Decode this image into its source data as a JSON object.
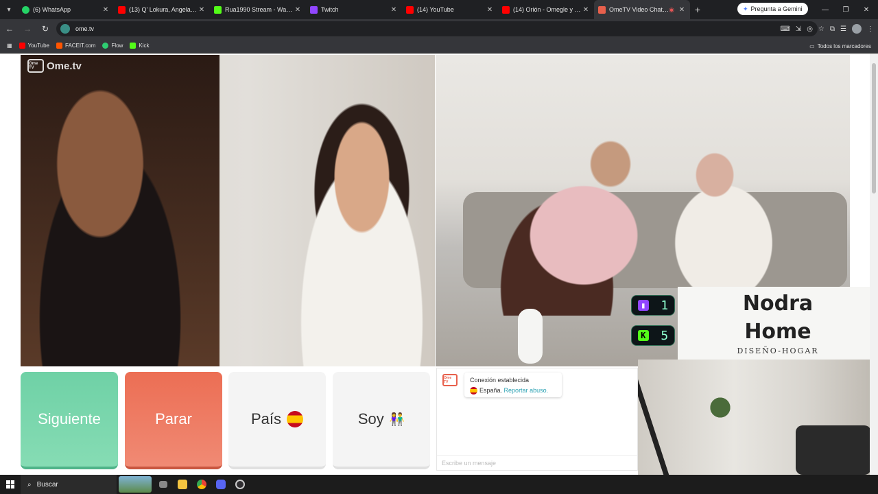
{
  "browser": {
    "tabs": [
      {
        "title": "(6) WhatsApp",
        "color": "#25d366",
        "icon": "whatsapp-icon"
      },
      {
        "title": "(13) Q' Lokura, Angela Lei",
        "color": "#ff0000",
        "icon": "youtube-icon"
      },
      {
        "title": "Rua1990 Stream - Watch L",
        "color": "#53fc18",
        "icon": "kick-icon"
      },
      {
        "title": "Twitch",
        "color": "#9146ff",
        "icon": "twitch-icon"
      },
      {
        "title": "(14) YouTube",
        "color": "#ff0000",
        "icon": "youtube-icon"
      },
      {
        "title": "(14) Orión - Omegle y su n",
        "color": "#ff0000",
        "icon": "youtube-icon"
      },
      {
        "title": "OmeTV Video Chat —",
        "color": "#e8604c",
        "icon": "ometv-icon"
      }
    ],
    "gemini_label": "Pregunta a Gemini",
    "url": "ome.tv",
    "bookmarks": [
      {
        "label": "YouTube",
        "color": "#ff0000"
      },
      {
        "label": "FACEIT.com",
        "color": "#ff5500"
      },
      {
        "label": "Flow",
        "color": "#2ecc71"
      },
      {
        "label": "Kick",
        "color": "#53fc18"
      }
    ],
    "all_bookmarks_label": "Todos los marcadores"
  },
  "ometv": {
    "logo_text": "Ome.tv",
    "logo_tv": "Ome TV",
    "buttons": {
      "next": "Siguiente",
      "stop": "Parar",
      "country": "País",
      "gender": "Soy"
    },
    "chat": {
      "connected": "Conexión establecida",
      "country": "España.",
      "report": "Reportar abuso.",
      "placeholder": "Escribe un mensaje"
    }
  },
  "overlay": {
    "twitch_count": "1",
    "kick_count": "5",
    "brand_line1": "Nodra",
    "brand_line2": "Home",
    "brand_sub": "DISEÑO-HOGAR"
  },
  "taskbar": {
    "search_label": "Buscar"
  }
}
